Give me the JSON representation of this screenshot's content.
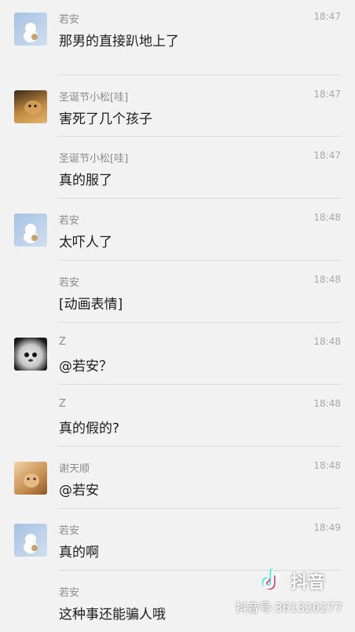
{
  "messages": [
    {
      "sender": "若安",
      "time": "18:47",
      "text": "那男的直接趴地上了",
      "avatar": "ruoan-cartoon-avatar"
    },
    {
      "sender": "圣诞节小松[哇]",
      "time": "18:47",
      "text": "害死了几个孩子",
      "avatar": "cat-photo-avatar"
    },
    {
      "sender": "圣诞节小松[哇]",
      "time": "18:47",
      "text": "真的服了",
      "avatar": null
    },
    {
      "sender": "若安",
      "time": "18:48",
      "text": "太吓人了",
      "avatar": "ruoan-cartoon-avatar"
    },
    {
      "sender": "若安",
      "time": "18:48",
      "text": "[动画表情]",
      "avatar": null
    },
    {
      "sender": "Z",
      "time": "18:48",
      "text": "@若安？",
      "avatar": "blob-face-avatar"
    },
    {
      "sender": "Z",
      "time": "18:48",
      "text": "真的假的?",
      "avatar": null
    },
    {
      "sender": "谢天顺",
      "time": "18:48",
      "text": "@若安",
      "avatar": "dog-photo-avatar"
    },
    {
      "sender": "若安",
      "time": "18:49",
      "text": "真的啊",
      "avatar": "ruoan-cartoon-avatar"
    },
    {
      "sender": "若安",
      "time": "",
      "text": "这种事还能骗人哦",
      "avatar": null
    }
  ],
  "watermark": {
    "brand": "抖音",
    "id_text": "抖音号:361320277",
    "logo": "douyin-note-icon"
  }
}
